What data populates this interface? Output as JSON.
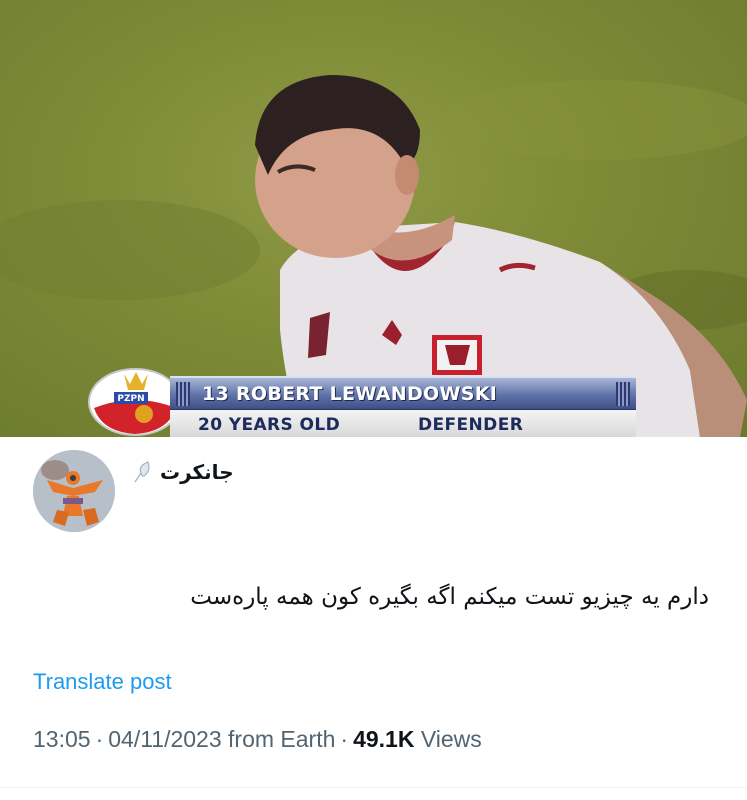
{
  "photo": {
    "caption": {
      "name_line": "13 ROBERT LEWANDOWSKI",
      "age": "20 YEARS OLD",
      "position": "DEFENDER"
    },
    "crest_text": "PZPN"
  },
  "tweet": {
    "author_name": "جانکرت",
    "badge_icon": "feather-icon",
    "text": "دارم یه چیزیو تست میکنم اگه بگیره کون همه پاره‌ست",
    "translate_label": "Translate post",
    "time": "13:05",
    "date": "04/11/2023",
    "location": "from Earth",
    "views_count": "49.1K",
    "views_label": "Views"
  },
  "colors": {
    "link": "#1d9bf0",
    "meta": "#536471",
    "text": "#0f1419"
  }
}
